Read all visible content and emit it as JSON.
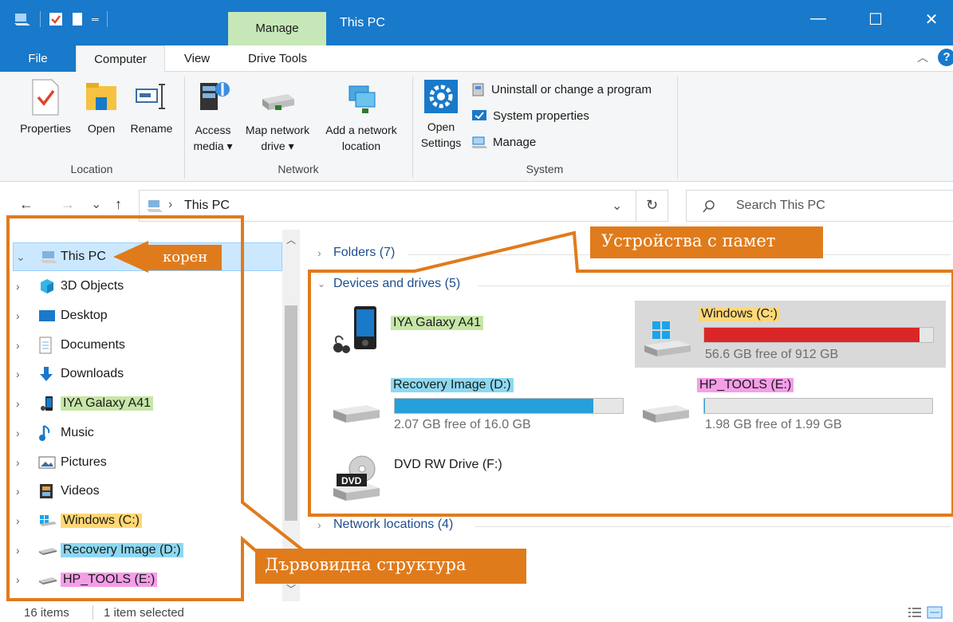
{
  "window": {
    "title": "This PC",
    "context_tab": "Manage",
    "controls": {
      "minimize": "—",
      "maximize": "☐",
      "close": "✕"
    }
  },
  "tabs": {
    "file": "File",
    "computer": "Computer",
    "view": "View",
    "drive_tools": "Drive Tools",
    "help": "?"
  },
  "ribbon": {
    "location": {
      "label": "Location",
      "properties": "Properties",
      "open": "Open",
      "rename": "Rename"
    },
    "network": {
      "label": "Network",
      "access_media": [
        "Access",
        "media ▾"
      ],
      "map_drive": [
        "Map network",
        "drive ▾"
      ],
      "add_location": [
        "Add a network",
        "location"
      ]
    },
    "system": {
      "label": "System",
      "open_settings": [
        "Open",
        "Settings"
      ],
      "uninstall": "Uninstall or change a program",
      "system_properties": "System properties",
      "manage": "Manage"
    }
  },
  "address": {
    "back": "←",
    "forward": "→",
    "recent": "⌄",
    "up": "↑",
    "separator": "›",
    "path": "This PC",
    "dropdown": "⌄",
    "refresh": "↻",
    "search_placeholder": "Search This PC"
  },
  "nav": {
    "root": "This PC",
    "items": [
      "3D Objects",
      "Desktop",
      "Documents",
      "Downloads",
      "IYA Galaxy A41",
      "Music",
      "Pictures",
      "Videos",
      "Windows (C:)",
      "Recovery Image (D:)",
      "HP_TOOLS (E:)"
    ],
    "expand_glyph": "›",
    "root_glyph": "⌄"
  },
  "content": {
    "folders_header": "Folders (7)",
    "devices_header": "Devices and drives (5)",
    "network_header": "Network locations (4)",
    "drives": {
      "phone": {
        "name": "IYA Galaxy A41"
      },
      "c": {
        "name": "Windows (C:)",
        "free": "56.6 GB free of 912 GB",
        "used_fraction": 0.94,
        "bar_color": "#da2626"
      },
      "d": {
        "name": "Recovery Image (D:)",
        "free": "2.07 GB free of 16.0 GB",
        "used_fraction": 0.87,
        "bar_color": "#26a0da"
      },
      "e": {
        "name": "HP_TOOLS (E:)",
        "free": "1.98 GB free of 1.99 GB",
        "used_fraction": 0.005,
        "bar_color": "#26a0da"
      },
      "f": {
        "name": "DVD RW Drive (F:)",
        "badge": "DVD"
      }
    }
  },
  "annotations": {
    "root_callout": "корен",
    "devices_callout": "Устройства с памет",
    "tree_callout": "Дървовидна структура"
  },
  "status": {
    "items": "16 items",
    "selected": "1 item selected"
  }
}
